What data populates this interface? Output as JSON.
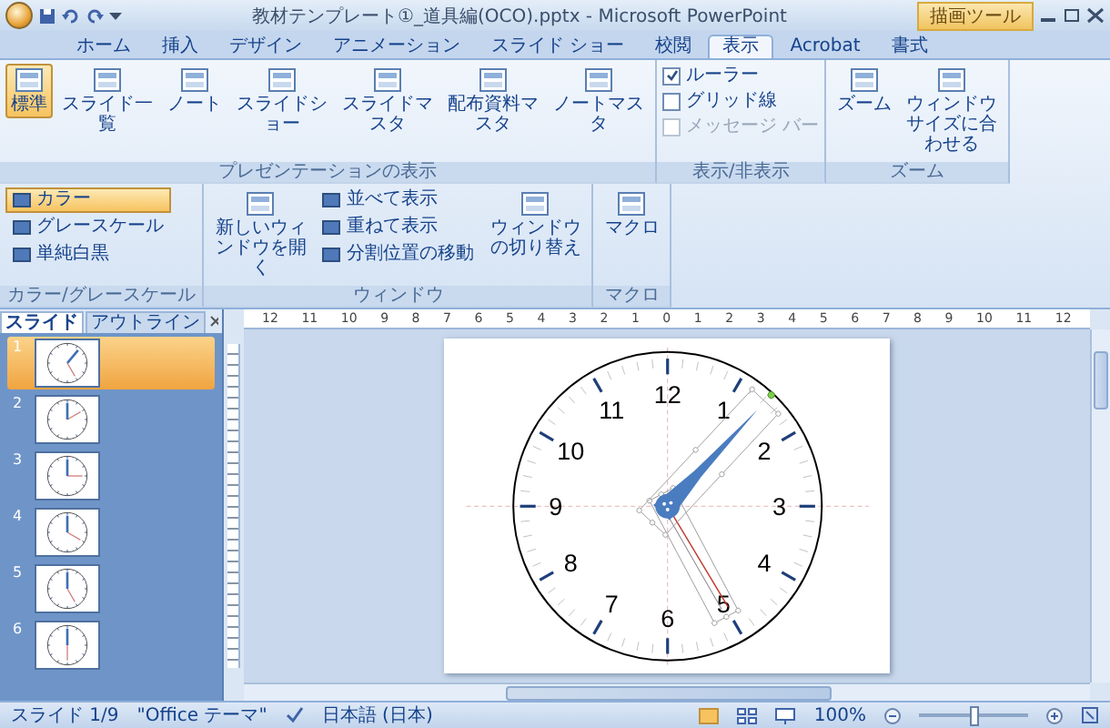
{
  "window": {
    "title": "教材テンプレート①_道具編(OCO).pptx - Microsoft PowerPoint",
    "context_group": "描画ツール"
  },
  "tabs": [
    {
      "label": "ホーム",
      "selected": false
    },
    {
      "label": "挿入",
      "selected": false
    },
    {
      "label": "デザイン",
      "selected": false
    },
    {
      "label": "アニメーション",
      "selected": false
    },
    {
      "label": "スライド ショー",
      "selected": false
    },
    {
      "label": "校閲",
      "selected": false
    },
    {
      "label": "表示",
      "selected": true
    },
    {
      "label": "Acrobat",
      "selected": false
    },
    {
      "label": "書式",
      "selected": false
    }
  ],
  "ribbon": {
    "groups": [
      {
        "label": "プレゼンテーションの表示",
        "items": [
          {
            "kind": "large",
            "label": "標準",
            "selected": true
          },
          {
            "kind": "large",
            "label": "スライド一覧",
            "selected": false
          },
          {
            "kind": "large",
            "label": "ノート",
            "selected": false
          },
          {
            "kind": "large",
            "label": "スライドショー",
            "selected": false
          },
          {
            "kind": "large",
            "label": "スライドマスタ",
            "selected": false
          },
          {
            "kind": "large",
            "label": "配布資料マスタ",
            "selected": false
          },
          {
            "kind": "large",
            "label": "ノートマスタ",
            "selected": false
          }
        ]
      },
      {
        "label": "表示/非表示",
        "items": [
          {
            "kind": "check",
            "label": "ルーラー",
            "checked": true,
            "disabled": false
          },
          {
            "kind": "check",
            "label": "グリッド線",
            "checked": false,
            "disabled": false
          },
          {
            "kind": "check",
            "label": "メッセージ バー",
            "checked": false,
            "disabled": true
          }
        ]
      },
      {
        "label": "ズーム",
        "items": [
          {
            "kind": "large",
            "label": "ズーム",
            "selected": false
          },
          {
            "kind": "large",
            "label": "ウィンドウサイズに合わせる",
            "selected": false
          }
        ]
      },
      {
        "label": "カラー/グレースケール",
        "items": [
          {
            "kind": "small",
            "label": "カラー",
            "selected": true
          },
          {
            "kind": "small",
            "label": "グレースケール",
            "selected": false
          },
          {
            "kind": "small",
            "label": "単純白黒",
            "selected": false
          }
        ]
      },
      {
        "label": "ウィンドウ",
        "items": [
          {
            "kind": "large",
            "label": "新しいウィンドウを開く",
            "selected": false
          },
          {
            "kind": "small",
            "label": "並べて表示",
            "selected": false
          },
          {
            "kind": "small",
            "label": "重ねて表示",
            "selected": false
          },
          {
            "kind": "small",
            "label": "分割位置の移動",
            "selected": false
          },
          {
            "kind": "large",
            "label": "ウィンドウの切り替え",
            "selected": false
          }
        ]
      },
      {
        "label": "マクロ",
        "items": [
          {
            "kind": "large",
            "label": "マクロ",
            "selected": false
          }
        ]
      }
    ]
  },
  "panel": {
    "tabs": [
      {
        "label": "スライド",
        "selected": true
      },
      {
        "label": "アウトライン",
        "selected": false
      }
    ],
    "slides": [
      {
        "number": "1",
        "selected": true
      },
      {
        "number": "2",
        "selected": false
      },
      {
        "number": "3",
        "selected": false
      },
      {
        "number": "4",
        "selected": false
      },
      {
        "number": "5",
        "selected": false
      },
      {
        "number": "6",
        "selected": false
      }
    ]
  },
  "ruler_numbers": [
    "12",
    "11",
    "10",
    "9",
    "8",
    "7",
    "6",
    "5",
    "4",
    "3",
    "2",
    "1",
    "0",
    "1",
    "2",
    "3",
    "4",
    "5",
    "6",
    "7",
    "8",
    "9",
    "10",
    "11",
    "12"
  ],
  "clock": {
    "numerals": [
      "12",
      "1",
      "2",
      "3",
      "4",
      "5",
      "6",
      "7",
      "8",
      "9",
      "10",
      "11"
    ]
  },
  "status_bar": {
    "slide": "スライド 1/9",
    "theme": "\"Office テーマ\"",
    "language": "日本語 (日本)",
    "zoom": "100%",
    "zoom_slider": {
      "level": 0.5
    }
  }
}
